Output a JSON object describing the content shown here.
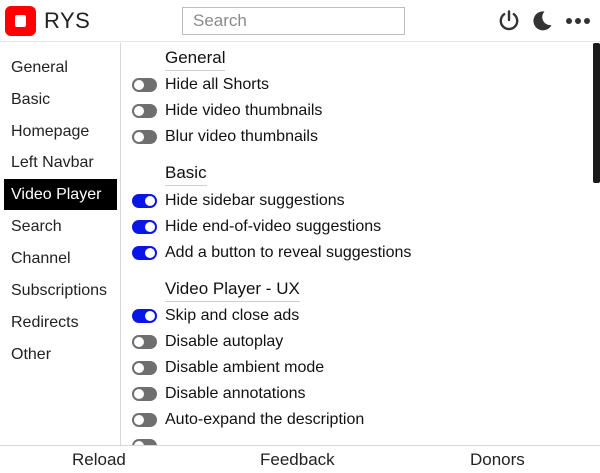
{
  "app": {
    "title": "RYS",
    "logo_icon": "stop-square-icon",
    "brand_color": "#ff0000"
  },
  "search": {
    "placeholder": "Search"
  },
  "header_icons": [
    "power-icon",
    "moon-icon",
    "more-dots-icon"
  ],
  "sidebar": {
    "items": [
      {
        "label": "General",
        "active": false
      },
      {
        "label": "Basic",
        "active": false
      },
      {
        "label": "Homepage",
        "active": false
      },
      {
        "label": "Left Navbar",
        "active": false
      },
      {
        "label": "Video Player",
        "active": true
      },
      {
        "label": "Search",
        "active": false
      },
      {
        "label": "Channel",
        "active": false
      },
      {
        "label": "Subscriptions",
        "active": false
      },
      {
        "label": "Redirects",
        "active": false
      },
      {
        "label": "Other",
        "active": false
      }
    ]
  },
  "sections": [
    {
      "title": "General",
      "options": [
        {
          "label": "Hide all Shorts",
          "on": false
        },
        {
          "label": "Hide video thumbnails",
          "on": false
        },
        {
          "label": "Blur video thumbnails",
          "on": false
        }
      ]
    },
    {
      "title": "Basic",
      "options": [
        {
          "label": "Hide sidebar suggestions",
          "on": true
        },
        {
          "label": "Hide end-of-video suggestions",
          "on": true
        },
        {
          "label": "Add a button to reveal suggestions",
          "on": true
        }
      ]
    },
    {
      "title": "Video Player - UX",
      "options": [
        {
          "label": "Skip and close ads",
          "on": true
        },
        {
          "label": "Disable autoplay",
          "on": false
        },
        {
          "label": "Disable ambient mode",
          "on": false
        },
        {
          "label": "Disable annotations",
          "on": false
        },
        {
          "label": "Auto-expand the description",
          "on": false
        }
      ]
    }
  ],
  "colors": {
    "toggle_on": "#0a16e6",
    "toggle_off": "#6f6f6f",
    "active_nav_bg": "#000000"
  },
  "footer": {
    "reload": "Reload",
    "feedback": "Feedback",
    "donors": "Donors"
  }
}
